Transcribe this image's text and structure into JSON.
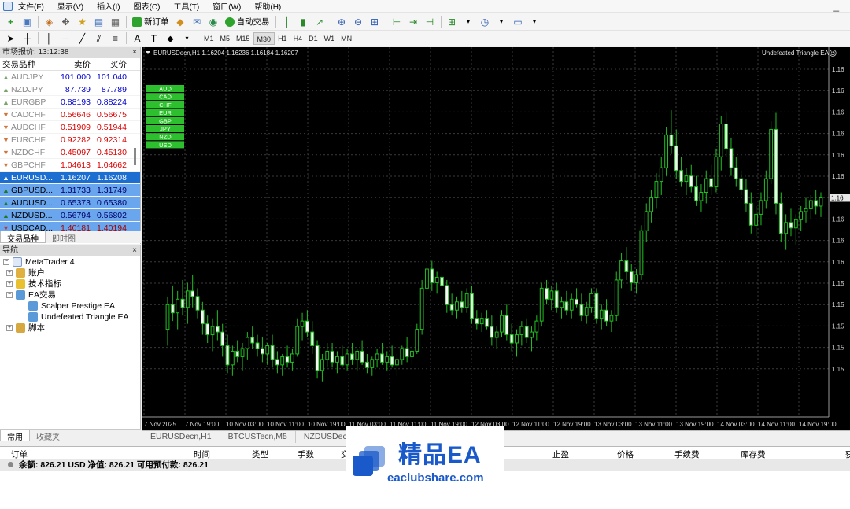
{
  "menubar": {
    "items": [
      "文件(F)",
      "显示(V)",
      "插入(I)",
      "图表(C)",
      "工具(T)",
      "窗口(W)",
      "帮助(H)"
    ],
    "window_control": "_"
  },
  "toolbar": {
    "new_order": "新订单",
    "auto_trading": "自动交易",
    "timeframes": [
      "M1",
      "M5",
      "M15",
      "M30",
      "H1",
      "H4",
      "D1",
      "W1",
      "MN"
    ],
    "active_timeframe": "M30"
  },
  "market_watch": {
    "title": "市场报价: 13:12:38",
    "close": "×",
    "headers": {
      "symbol": "交易品种",
      "bid": "卖价",
      "ask": "买价"
    },
    "rows": [
      {
        "symbol": "AUDJPY",
        "bid": "101.000",
        "ask": "101.040",
        "dir": "up",
        "style": "dim",
        "color": "blue"
      },
      {
        "symbol": "NZDJPY",
        "bid": "87.739",
        "ask": "87.789",
        "dir": "up",
        "style": "dim",
        "color": "blue"
      },
      {
        "symbol": "EURGBP",
        "bid": "0.88193",
        "ask": "0.88224",
        "dir": "up",
        "style": "dim",
        "color": "blue"
      },
      {
        "symbol": "CADCHF",
        "bid": "0.56646",
        "ask": "0.56675",
        "dir": "down",
        "style": "dimred",
        "color": "red"
      },
      {
        "symbol": "AUDCHF",
        "bid": "0.51909",
        "ask": "0.51944",
        "dir": "down",
        "style": "dimred",
        "color": "red"
      },
      {
        "symbol": "EURCHF",
        "bid": "0.92282",
        "ask": "0.92314",
        "dir": "down",
        "style": "dimred",
        "color": "red"
      },
      {
        "symbol": "NZDCHF",
        "bid": "0.45097",
        "ask": "0.45130",
        "dir": "down",
        "style": "dimred",
        "color": "red"
      },
      {
        "symbol": "GBPCHF",
        "bid": "1.04613",
        "ask": "1.04662",
        "dir": "down",
        "style": "dimred",
        "color": "red"
      },
      {
        "symbol": "EURUSD...",
        "bid": "1.16207",
        "ask": "1.16208",
        "dir": "up",
        "style": "sel",
        "color": "white"
      },
      {
        "symbol": "GBPUSD...",
        "bid": "1.31733",
        "ask": "1.31749",
        "dir": "up",
        "style": "bl",
        "color": "blue"
      },
      {
        "symbol": "AUDUSD...",
        "bid": "0.65373",
        "ask": "0.65380",
        "dir": "up",
        "style": "bl",
        "color": "blue"
      },
      {
        "symbol": "NZDUSD...",
        "bid": "0.56794",
        "ask": "0.56802",
        "dir": "up",
        "style": "bl",
        "color": "blue"
      },
      {
        "symbol": "USDCAD...",
        "bid": "1.40181",
        "ask": "1.40194",
        "dir": "down",
        "style": "blr",
        "color": "red"
      }
    ],
    "tabs": [
      "交易品种",
      "即时图"
    ]
  },
  "navigator": {
    "title": "导航",
    "close": "×",
    "root": "MetaTrader 4",
    "items": [
      {
        "label": "账户",
        "level": 1,
        "toggle": "+",
        "icon_color": "#e0b040"
      },
      {
        "label": "技术指标",
        "level": 1,
        "toggle": "+",
        "icon_color": "#e8c030"
      },
      {
        "label": "EA交易",
        "level": 1,
        "toggle": "−",
        "icon_color": "#5a9ad8"
      },
      {
        "label": "Scalper Prestige EA",
        "level": 2,
        "toggle": "",
        "icon_color": "#5a9ad8"
      },
      {
        "label": "Undefeated Triangle EA",
        "level": 2,
        "toggle": "",
        "icon_color": "#5a9ad8"
      },
      {
        "label": "脚本",
        "level": 1,
        "toggle": "+",
        "icon_color": "#d8a840"
      }
    ],
    "tabs": [
      "常用",
      "收藏夹"
    ]
  },
  "chart": {
    "header": "EURUSDecn,H1  1.16204 1.16236 1.16184 1.16207",
    "ea_name": "Undefeated Triangle EA",
    "smiley": "☺",
    "currency_labels": [
      "AUD",
      "CAD",
      "CHF",
      "EUR",
      "GBP",
      "JPY",
      "NZD",
      "USD"
    ],
    "current_price_label": "1.16",
    "tabs": [
      "EURUSDecn,H1",
      "BTCUSTecn,M5",
      "NZDUSDecn,M"
    ]
  },
  "chart_data": {
    "type": "candlestick",
    "symbol": "EURUSDecn",
    "timeframe": "H1",
    "x_tick_labels": [
      "7 Nov 2025",
      "7 Nov 19:00",
      "10 Nov 03:00",
      "10 Nov 11:00",
      "10 Nov 19:00",
      "11 Nov 03:00",
      "11 Nov 11:00",
      "11 Nov 19:00",
      "12 Nov 03:00",
      "12 Nov 11:00",
      "12 Nov 19:00",
      "13 Nov 03:00",
      "13 Nov 11:00",
      "13 Nov 19:00",
      "14 Nov 03:00",
      "14 Nov 11:00",
      "14 Nov 19:00"
    ],
    "y_tick_labels": [
      "1.16",
      "1.16",
      "1.16",
      "1.16",
      "1.16",
      "1.16",
      "1.16",
      "1.16",
      "1.16",
      "1.16",
      "1.15",
      "1.15",
      "1.15",
      "1.15",
      "1.15"
    ],
    "ylim": [
      1.153,
      1.1665
    ],
    "ohlc": [
      [
        1.1562,
        1.1574,
        1.1556,
        1.1571
      ],
      [
        1.1571,
        1.1578,
        1.1565,
        1.1568
      ],
      [
        1.1568,
        1.1576,
        1.1562,
        1.1573
      ],
      [
        1.1573,
        1.158,
        1.1567,
        1.157
      ],
      [
        1.157,
        1.1579,
        1.1564,
        1.1576
      ],
      [
        1.1576,
        1.1582,
        1.157,
        1.1574
      ],
      [
        1.1574,
        1.1577,
        1.1566,
        1.1569
      ],
      [
        1.1569,
        1.1572,
        1.156,
        1.1564
      ],
      [
        1.1564,
        1.1567,
        1.1557,
        1.156
      ],
      [
        1.156,
        1.1566,
        1.1554,
        1.1563
      ],
      [
        1.1563,
        1.1569,
        1.1558,
        1.1561
      ],
      [
        1.1561,
        1.1564,
        1.1552,
        1.1556
      ],
      [
        1.1556,
        1.156,
        1.1546,
        1.1549
      ],
      [
        1.1549,
        1.1556,
        1.1545,
        1.1554
      ],
      [
        1.1554,
        1.1558,
        1.155,
        1.1552
      ],
      [
        1.1552,
        1.1557,
        1.1547,
        1.1555
      ],
      [
        1.1555,
        1.1561,
        1.1551,
        1.1559
      ],
      [
        1.1559,
        1.1563,
        1.1555,
        1.1557
      ],
      [
        1.1557,
        1.156,
        1.1552,
        1.1555
      ],
      [
        1.1555,
        1.1559,
        1.155,
        1.1553
      ],
      [
        1.1553,
        1.1557,
        1.1549,
        1.1556
      ],
      [
        1.1556,
        1.156,
        1.1548,
        1.1551
      ],
      [
        1.1551,
        1.1554,
        1.1546,
        1.1549
      ],
      [
        1.1549,
        1.1553,
        1.1545,
        1.1552
      ],
      [
        1.1552,
        1.1556,
        1.1548,
        1.155
      ],
      [
        1.155,
        1.1555,
        1.1547,
        1.1553
      ],
      [
        1.1553,
        1.1566,
        1.1552,
        1.1563
      ],
      [
        1.1563,
        1.1568,
        1.1558,
        1.1565
      ],
      [
        1.1565,
        1.1569,
        1.1559,
        1.1561
      ],
      [
        1.1561,
        1.1565,
        1.1553,
        1.1556
      ],
      [
        1.1556,
        1.1558,
        1.1544,
        1.1547
      ],
      [
        1.1547,
        1.1553,
        1.1543,
        1.1551
      ],
      [
        1.1551,
        1.1557,
        1.1548,
        1.1554
      ],
      [
        1.1554,
        1.1557,
        1.1548,
        1.155
      ],
      [
        1.155,
        1.1554,
        1.1546,
        1.1552
      ],
      [
        1.1552,
        1.1556,
        1.1548,
        1.1549
      ],
      [
        1.1549,
        1.1555,
        1.1547,
        1.1553
      ],
      [
        1.1553,
        1.1557,
        1.1549,
        1.1551
      ],
      [
        1.1551,
        1.1555,
        1.1547,
        1.1554
      ],
      [
        1.1554,
        1.1558,
        1.1549,
        1.155
      ],
      [
        1.155,
        1.1553,
        1.1546,
        1.1548
      ],
      [
        1.1548,
        1.1552,
        1.1545,
        1.1551
      ],
      [
        1.1551,
        1.1555,
        1.1548,
        1.1553
      ],
      [
        1.1553,
        1.1557,
        1.1549,
        1.155
      ],
      [
        1.155,
        1.1554,
        1.1547,
        1.1552
      ],
      [
        1.1552,
        1.1556,
        1.1548,
        1.1549
      ],
      [
        1.1549,
        1.1553,
        1.1545,
        1.1551
      ],
      [
        1.1551,
        1.1556,
        1.1549,
        1.1555
      ],
      [
        1.1555,
        1.1559,
        1.155,
        1.1552
      ],
      [
        1.1552,
        1.1556,
        1.1549,
        1.1554
      ],
      [
        1.1554,
        1.1564,
        1.1553,
        1.1562
      ],
      [
        1.1562,
        1.158,
        1.156,
        1.1577
      ],
      [
        1.1577,
        1.1587,
        1.1573,
        1.1584
      ],
      [
        1.1584,
        1.1587,
        1.1576,
        1.1579
      ],
      [
        1.1579,
        1.1583,
        1.1575,
        1.1581
      ],
      [
        1.1581,
        1.1585,
        1.1577,
        1.1578
      ],
      [
        1.1578,
        1.158,
        1.1568,
        1.1571
      ],
      [
        1.1571,
        1.1575,
        1.1567,
        1.1569
      ],
      [
        1.1569,
        1.1574,
        1.1566,
        1.1572
      ],
      [
        1.1572,
        1.1576,
        1.1568,
        1.157
      ],
      [
        1.157,
        1.1577,
        1.1568,
        1.1575
      ],
      [
        1.1575,
        1.1578,
        1.1564,
        1.1566
      ],
      [
        1.1566,
        1.1569,
        1.1562,
        1.1564
      ],
      [
        1.1564,
        1.1568,
        1.1561,
        1.1566
      ],
      [
        1.1566,
        1.1569,
        1.1562,
        1.1563
      ],
      [
        1.1563,
        1.1567,
        1.1556,
        1.1559
      ],
      [
        1.1559,
        1.1563,
        1.1555,
        1.1561
      ],
      [
        1.1561,
        1.1569,
        1.1559,
        1.1567
      ],
      [
        1.1567,
        1.1571,
        1.1558,
        1.156
      ],
      [
        1.156,
        1.1564,
        1.1554,
        1.1557
      ],
      [
        1.1557,
        1.1562,
        1.1552,
        1.156
      ],
      [
        1.156,
        1.1565,
        1.1556,
        1.1563
      ],
      [
        1.1563,
        1.1566,
        1.1557,
        1.1559
      ],
      [
        1.1559,
        1.1563,
        1.1554,
        1.1561
      ],
      [
        1.1561,
        1.1567,
        1.1558,
        1.1565
      ],
      [
        1.1565,
        1.1579,
        1.1563,
        1.1577
      ],
      [
        1.1577,
        1.158,
        1.1571,
        1.1573
      ],
      [
        1.1573,
        1.1578,
        1.1569,
        1.1576
      ],
      [
        1.1576,
        1.1579,
        1.1568,
        1.157
      ],
      [
        1.157,
        1.1574,
        1.1566,
        1.1572
      ],
      [
        1.1572,
        1.1576,
        1.1567,
        1.1569
      ],
      [
        1.1569,
        1.1575,
        1.1566,
        1.1573
      ],
      [
        1.1573,
        1.1577,
        1.157,
        1.1571
      ],
      [
        1.1571,
        1.1575,
        1.1565,
        1.1567
      ],
      [
        1.1567,
        1.1572,
        1.1564,
        1.157
      ],
      [
        1.157,
        1.1577,
        1.1568,
        1.1575
      ],
      [
        1.1575,
        1.1577,
        1.1564,
        1.1566
      ],
      [
        1.1566,
        1.1571,
        1.1562,
        1.1569
      ],
      [
        1.1569,
        1.1573,
        1.1563,
        1.1565
      ],
      [
        1.1565,
        1.1569,
        1.1561,
        1.1567
      ],
      [
        1.1567,
        1.1583,
        1.1565,
        1.158
      ],
      [
        1.158,
        1.159,
        1.1577,
        1.1587
      ],
      [
        1.1587,
        1.1592,
        1.158,
        1.1583
      ],
      [
        1.1583,
        1.1586,
        1.1576,
        1.1579
      ],
      [
        1.1579,
        1.1584,
        1.1575,
        1.1582
      ],
      [
        1.1582,
        1.16,
        1.158,
        1.1598
      ],
      [
        1.1598,
        1.1608,
        1.1594,
        1.1605
      ],
      [
        1.1605,
        1.1613,
        1.1601,
        1.161
      ],
      [
        1.161,
        1.1619,
        1.1606,
        1.1616
      ],
      [
        1.1616,
        1.1625,
        1.1611,
        1.1621
      ],
      [
        1.1621,
        1.1636,
        1.1618,
        1.1633
      ],
      [
        1.1633,
        1.1642,
        1.1626,
        1.1629
      ],
      [
        1.1629,
        1.1635,
        1.1617,
        1.162
      ],
      [
        1.162,
        1.1625,
        1.1614,
        1.1616
      ],
      [
        1.1616,
        1.1621,
        1.1611,
        1.1618
      ],
      [
        1.1618,
        1.1622,
        1.1612,
        1.1614
      ],
      [
        1.1614,
        1.1618,
        1.1607,
        1.1609
      ],
      [
        1.1609,
        1.1615,
        1.1605,
        1.1612
      ],
      [
        1.1612,
        1.162,
        1.1608,
        1.1617
      ],
      [
        1.1617,
        1.1622,
        1.1611,
        1.1614
      ],
      [
        1.1614,
        1.1628,
        1.1612,
        1.1625
      ],
      [
        1.1625,
        1.164,
        1.162,
        1.1637
      ],
      [
        1.1637,
        1.1641,
        1.1625,
        1.1628
      ],
      [
        1.1628,
        1.1632,
        1.1618,
        1.1621
      ],
      [
        1.1621,
        1.1625,
        1.1614,
        1.1617
      ],
      [
        1.1617,
        1.162,
        1.1611,
        1.1613
      ],
      [
        1.1613,
        1.1617,
        1.1605,
        1.1608
      ],
      [
        1.1608,
        1.1612,
        1.1597,
        1.16
      ],
      [
        1.16,
        1.1607,
        1.1596,
        1.1604
      ],
      [
        1.1604,
        1.1612,
        1.16,
        1.1609
      ],
      [
        1.1609,
        1.162,
        1.1606,
        1.1617
      ],
      [
        1.1617,
        1.1638,
        1.1615,
        1.1635
      ],
      [
        1.1635,
        1.1641,
        1.1604,
        1.1608
      ],
      [
        1.1608,
        1.1612,
        1.1594,
        1.1597
      ],
      [
        1.1597,
        1.1604,
        1.1591,
        1.1601
      ],
      [
        1.1601,
        1.1606,
        1.1596,
        1.1599
      ],
      [
        1.1599,
        1.1604,
        1.1593,
        1.1602
      ],
      [
        1.1602,
        1.1607,
        1.1598,
        1.1605
      ],
      [
        1.1605,
        1.161,
        1.1601,
        1.1606
      ],
      [
        1.1606,
        1.1611,
        1.1602,
        1.1609
      ],
      [
        1.1609,
        1.1613,
        1.1604,
        1.1607
      ],
      [
        1.1607,
        1.1612,
        1.1603,
        1.161
      ]
    ]
  },
  "terminal": {
    "columns": [
      "订单",
      "时间",
      "类型",
      "手数",
      "交",
      "止盈",
      "价格",
      "手续费",
      "库存费",
      "获"
    ],
    "balance_line": "余额: 826.21 USD  净值: 826.21  可用预付款: 826.21"
  },
  "watermark": {
    "title": "精品EA",
    "url": "eaclubshare.com"
  }
}
